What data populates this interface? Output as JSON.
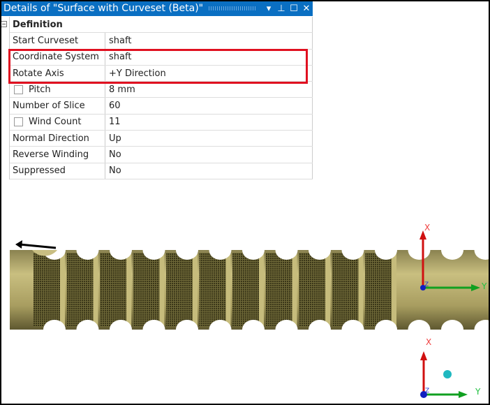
{
  "panel": {
    "title": "Details of \"Surface with Curveset (Beta)\"",
    "section": "Definition",
    "rows": [
      {
        "label": "Start Curveset",
        "value": "shaft"
      },
      {
        "label": "Coordinate System",
        "value": "shaft"
      },
      {
        "label": "Rotate Axis",
        "value": "+Y Direction"
      },
      {
        "label": "Pitch",
        "value": "8 mm",
        "checkbox": true
      },
      {
        "label": "Number of Slice",
        "value": "60"
      },
      {
        "label": "Wind Count",
        "value": "11",
        "checkbox": true
      },
      {
        "label": "Normal Direction",
        "value": "Up"
      },
      {
        "label": "Reverse Winding",
        "value": "No"
      },
      {
        "label": "Suppressed",
        "value": "No"
      }
    ]
  },
  "triad": {
    "x": "X",
    "y": "Y",
    "z": "Z"
  },
  "colors": {
    "title_bar": "#0a6fc2",
    "highlight": "#e01020",
    "shaft": "#b8ad6c"
  }
}
